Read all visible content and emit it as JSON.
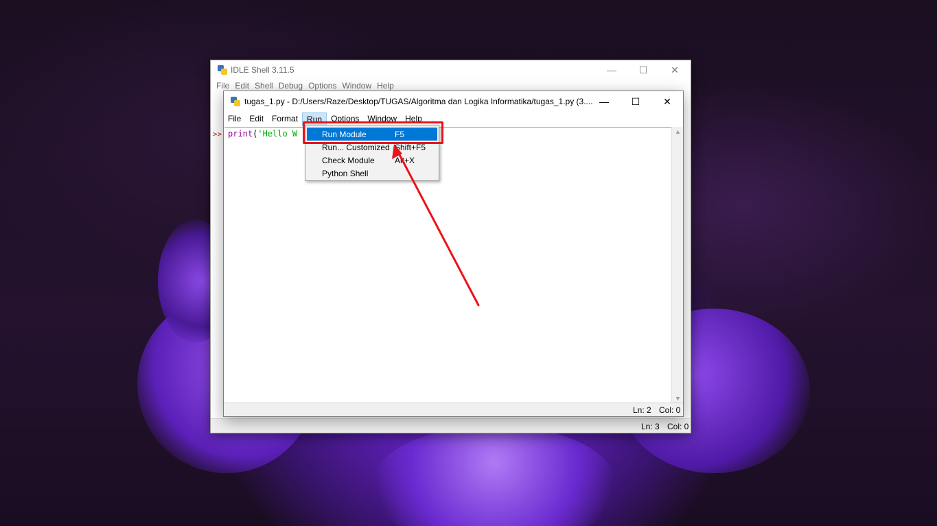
{
  "shell": {
    "title": "IDLE Shell 3.11.5",
    "menu": [
      "File",
      "Edit",
      "Shell",
      "Debug",
      "Options",
      "Window",
      "Help"
    ],
    "prompt": ">>",
    "status_ln": "Ln: 3",
    "status_col": "Col: 0"
  },
  "editor": {
    "title": "tugas_1.py - D:/Users/Raze/Desktop/TUGAS/Algoritma dan Logika Informatika/tugas_1.py (3....",
    "menu": [
      "File",
      "Edit",
      "Format",
      "Run",
      "Options",
      "Window",
      "Help"
    ],
    "active_menu": "Run",
    "code": {
      "keyword": "print",
      "open": "(",
      "string_visible": "'Hello W"
    },
    "status_ln": "Ln: 2",
    "status_col": "Col: 0"
  },
  "run_menu": {
    "items": [
      {
        "label": "Run Module",
        "shortcut": "F5",
        "selected": true
      },
      {
        "label": "Run... Customized",
        "shortcut": "Shift+F5",
        "selected": false
      },
      {
        "label": "Check Module",
        "shortcut": "Alt+X",
        "selected": false
      },
      {
        "label": "Python Shell",
        "shortcut": "",
        "selected": false
      }
    ]
  },
  "window_controls": {
    "minimize": "—",
    "maximize": "☐",
    "close": "✕"
  },
  "colors": {
    "highlight": "#0078d7",
    "annotation": "#e8141a",
    "keyword": "#900090",
    "string": "#00aa00",
    "prompt": "#b42222"
  },
  "icons": [
    "python-idle-icon",
    "minimize-icon",
    "maximize-icon",
    "close-icon",
    "scroll-up-arrow-icon",
    "scroll-down-arrow-icon",
    "annotation-arrow"
  ]
}
